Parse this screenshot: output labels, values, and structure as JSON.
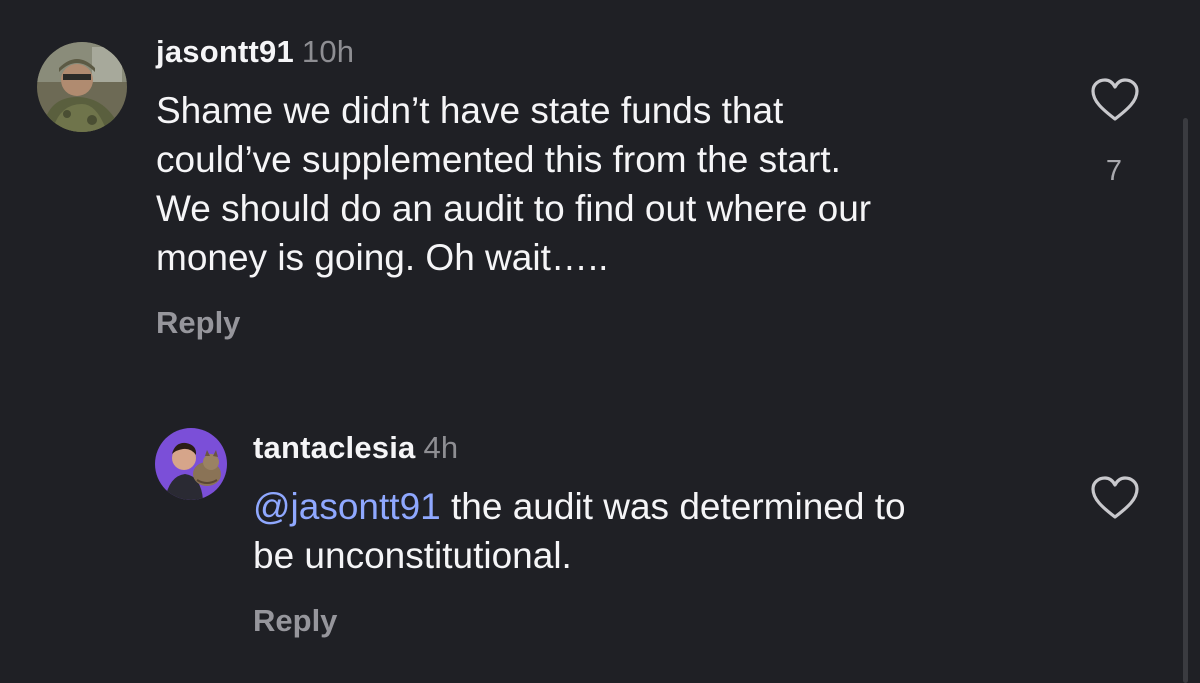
{
  "comments": [
    {
      "username": "jasontt91",
      "time": "10h",
      "lines": [
        "Shame we didn’t have state funds that",
        "could’ve supplemented this from the start.",
        "We should do an audit to find out where our",
        "money is going. Oh wait….."
      ],
      "reply_label": "Reply",
      "like_count": "7",
      "like_icon": "heart-outline-icon"
    },
    {
      "username": "tantaclesia",
      "time": "4h",
      "mention": "@jasontt91",
      "line1_rest": " the audit was determined to",
      "line2": "be unconstitutional.",
      "reply_label": "Reply",
      "like_icon": "heart-outline-icon"
    }
  ],
  "colors": {
    "background": "#1f2025",
    "mention": "#8fa8ff",
    "muted": "#96969c"
  }
}
